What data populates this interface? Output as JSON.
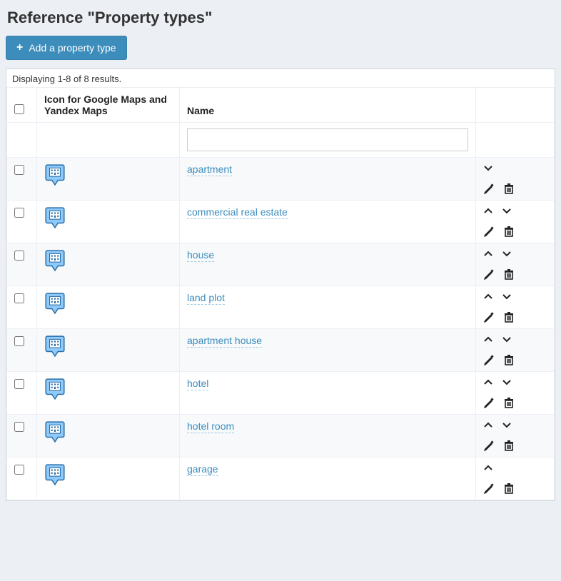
{
  "page": {
    "title": "Reference \"Property types\"",
    "add_button_label": "Add a property type"
  },
  "grid": {
    "summary": "Displaying 1-8 of 8 results.",
    "columns": {
      "icon": "Icon for Google Maps and Yandex Maps",
      "name": "Name"
    },
    "filter": {
      "name_value": ""
    },
    "rows": [
      {
        "name": "apartment",
        "icon": "building-pin-icon",
        "show_up": false,
        "show_down": true
      },
      {
        "name": "commercial real estate",
        "icon": "building-pin-icon",
        "show_up": true,
        "show_down": true
      },
      {
        "name": "house",
        "icon": "building-pin-icon",
        "show_up": true,
        "show_down": true
      },
      {
        "name": "land plot",
        "icon": "building-pin-icon",
        "show_up": true,
        "show_down": true
      },
      {
        "name": "apartment house",
        "icon": "building-pin-icon",
        "show_up": true,
        "show_down": true
      },
      {
        "name": "hotel",
        "icon": "building-pin-icon",
        "show_up": true,
        "show_down": true
      },
      {
        "name": "hotel room",
        "icon": "building-pin-icon",
        "show_up": true,
        "show_down": true
      },
      {
        "name": "garage",
        "icon": "building-pin-icon",
        "show_up": true,
        "show_down": false
      }
    ]
  }
}
